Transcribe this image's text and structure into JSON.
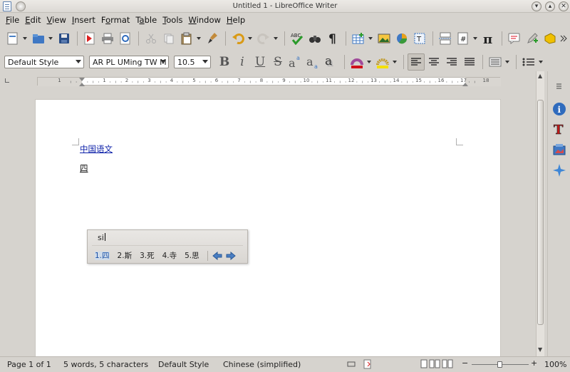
{
  "window": {
    "title": "Untitled 1 - LibreOffice Writer"
  },
  "menubar": {
    "items": [
      {
        "u": "F",
        "rest": "ile"
      },
      {
        "u": "E",
        "rest": "dit"
      },
      {
        "u": "V",
        "rest": "iew"
      },
      {
        "u": "I",
        "rest": "nsert"
      },
      {
        "pre": "F",
        "u": "o",
        "rest": "rmat"
      },
      {
        "pre": "T",
        "u": "a",
        "rest": "ble"
      },
      {
        "u": "T",
        "rest": "ools"
      },
      {
        "u": "W",
        "rest": "indow"
      },
      {
        "u": "H",
        "rest": "elp"
      }
    ]
  },
  "formatting": {
    "paragraph_style": "Default Style",
    "font_name": "AR PL UMing TW M",
    "font_size": "10.5"
  },
  "document": {
    "paragraphs": [
      "中国语文",
      "四"
    ]
  },
  "ime": {
    "preedit": "si",
    "candidates": [
      {
        "num": "1.",
        "text": "四",
        "selected": true
      },
      {
        "num": "2.",
        "text": "斯"
      },
      {
        "num": "3.",
        "text": "死"
      },
      {
        "num": "4.",
        "text": "寺"
      },
      {
        "num": "5.",
        "text": "思"
      }
    ]
  },
  "ruler": {
    "labels": [
      "1",
      "1",
      "2",
      "3",
      "4",
      "5",
      "6",
      "7",
      "8",
      "9",
      "10",
      "11",
      "12",
      "13",
      "14",
      "15",
      "16",
      "17",
      "18"
    ]
  },
  "statusbar": {
    "page": "Page 1 of 1",
    "words": "5 words, 5 characters",
    "style": "Default Style",
    "language": "Chinese (simplified)",
    "zoom_minus": "−",
    "zoom_plus": "+",
    "zoom": "100%",
    "zoom_level": 1.0
  },
  "colors": {
    "accent": "#2f6bbd",
    "link": "#0b1fa8",
    "highlight": "#f4e000",
    "font_color": "#d0101a"
  }
}
